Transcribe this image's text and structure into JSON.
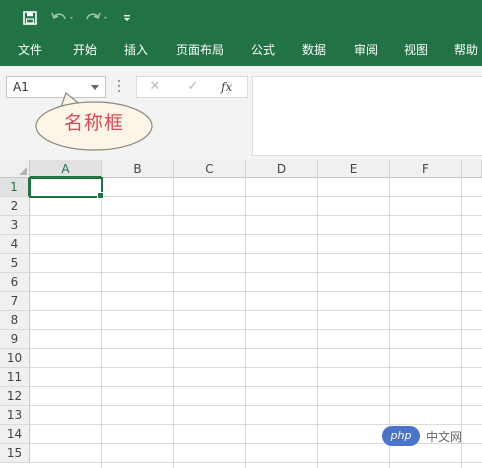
{
  "quick_access": {
    "save_icon": "save-icon",
    "undo_icon": "undo-icon",
    "redo_icon": "redo-icon",
    "customize_icon": "customize-qat-icon"
  },
  "ribbon_tabs": [
    {
      "label": "文件"
    },
    {
      "label": "开始"
    },
    {
      "label": "插入"
    },
    {
      "label": "页面布局"
    },
    {
      "label": "公式"
    },
    {
      "label": "数据"
    },
    {
      "label": "审阅"
    },
    {
      "label": "视图"
    },
    {
      "label": "帮助"
    }
  ],
  "formula_bar": {
    "name_box_value": "A1",
    "cancel_symbol": "✕",
    "enter_symbol": "✓",
    "fx_symbol": "fx",
    "formula_value": ""
  },
  "callout": {
    "text": "名称框"
  },
  "sheet": {
    "columns": [
      "A",
      "B",
      "C",
      "D",
      "E",
      "F"
    ],
    "rows": [
      "1",
      "2",
      "3",
      "4",
      "5",
      "6",
      "7",
      "8",
      "9",
      "10",
      "11",
      "12",
      "13",
      "14",
      "15"
    ],
    "active_cell": "A1"
  },
  "watermark": {
    "logo_text": "php",
    "text": "中文网"
  },
  "colors": {
    "accent": "#217346",
    "callout_text": "#d94a56"
  }
}
